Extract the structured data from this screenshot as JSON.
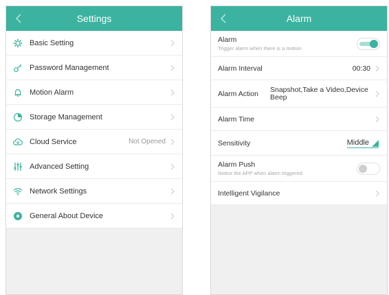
{
  "left": {
    "title": "Settings",
    "items": [
      {
        "label": "Basic Setting",
        "value": "",
        "icon": "gear-icon"
      },
      {
        "label": "Password Management",
        "value": "",
        "icon": "key-icon"
      },
      {
        "label": "Motion Alarm",
        "value": "",
        "icon": "bell-icon"
      },
      {
        "label": "Storage Management",
        "value": "",
        "icon": "storage-icon"
      },
      {
        "label": "Cloud Service",
        "value": "Not Opened",
        "icon": "cloud-icon"
      },
      {
        "label": "Advanced Setting",
        "value": "",
        "icon": "sliders-icon"
      },
      {
        "label": "Network Settings",
        "value": "",
        "icon": "wifi-icon"
      },
      {
        "label": "General About Device",
        "value": "",
        "icon": "info-gear-icon"
      }
    ]
  },
  "right": {
    "title": "Alarm",
    "alarm": {
      "label": "Alarm",
      "sub": "Trigger alarm when there is a motion",
      "enabled": true
    },
    "interval": {
      "label": "Alarm Interval",
      "value": "00:30"
    },
    "action": {
      "label": "Alarm Action",
      "value": "Snapshot,Take a Video,Device Beep"
    },
    "time": {
      "label": "Alarm Time"
    },
    "sensitivity": {
      "label": "Sensitivity",
      "value": "Middle"
    },
    "push": {
      "label": "Alarm Push",
      "sub": "Notice the APP when alarm triggered",
      "enabled": false
    },
    "vigilance": {
      "label": "Intelligent Vigilance"
    }
  },
  "colors": {
    "accent": "#3bb3a0",
    "background": "#f0f0f0"
  }
}
